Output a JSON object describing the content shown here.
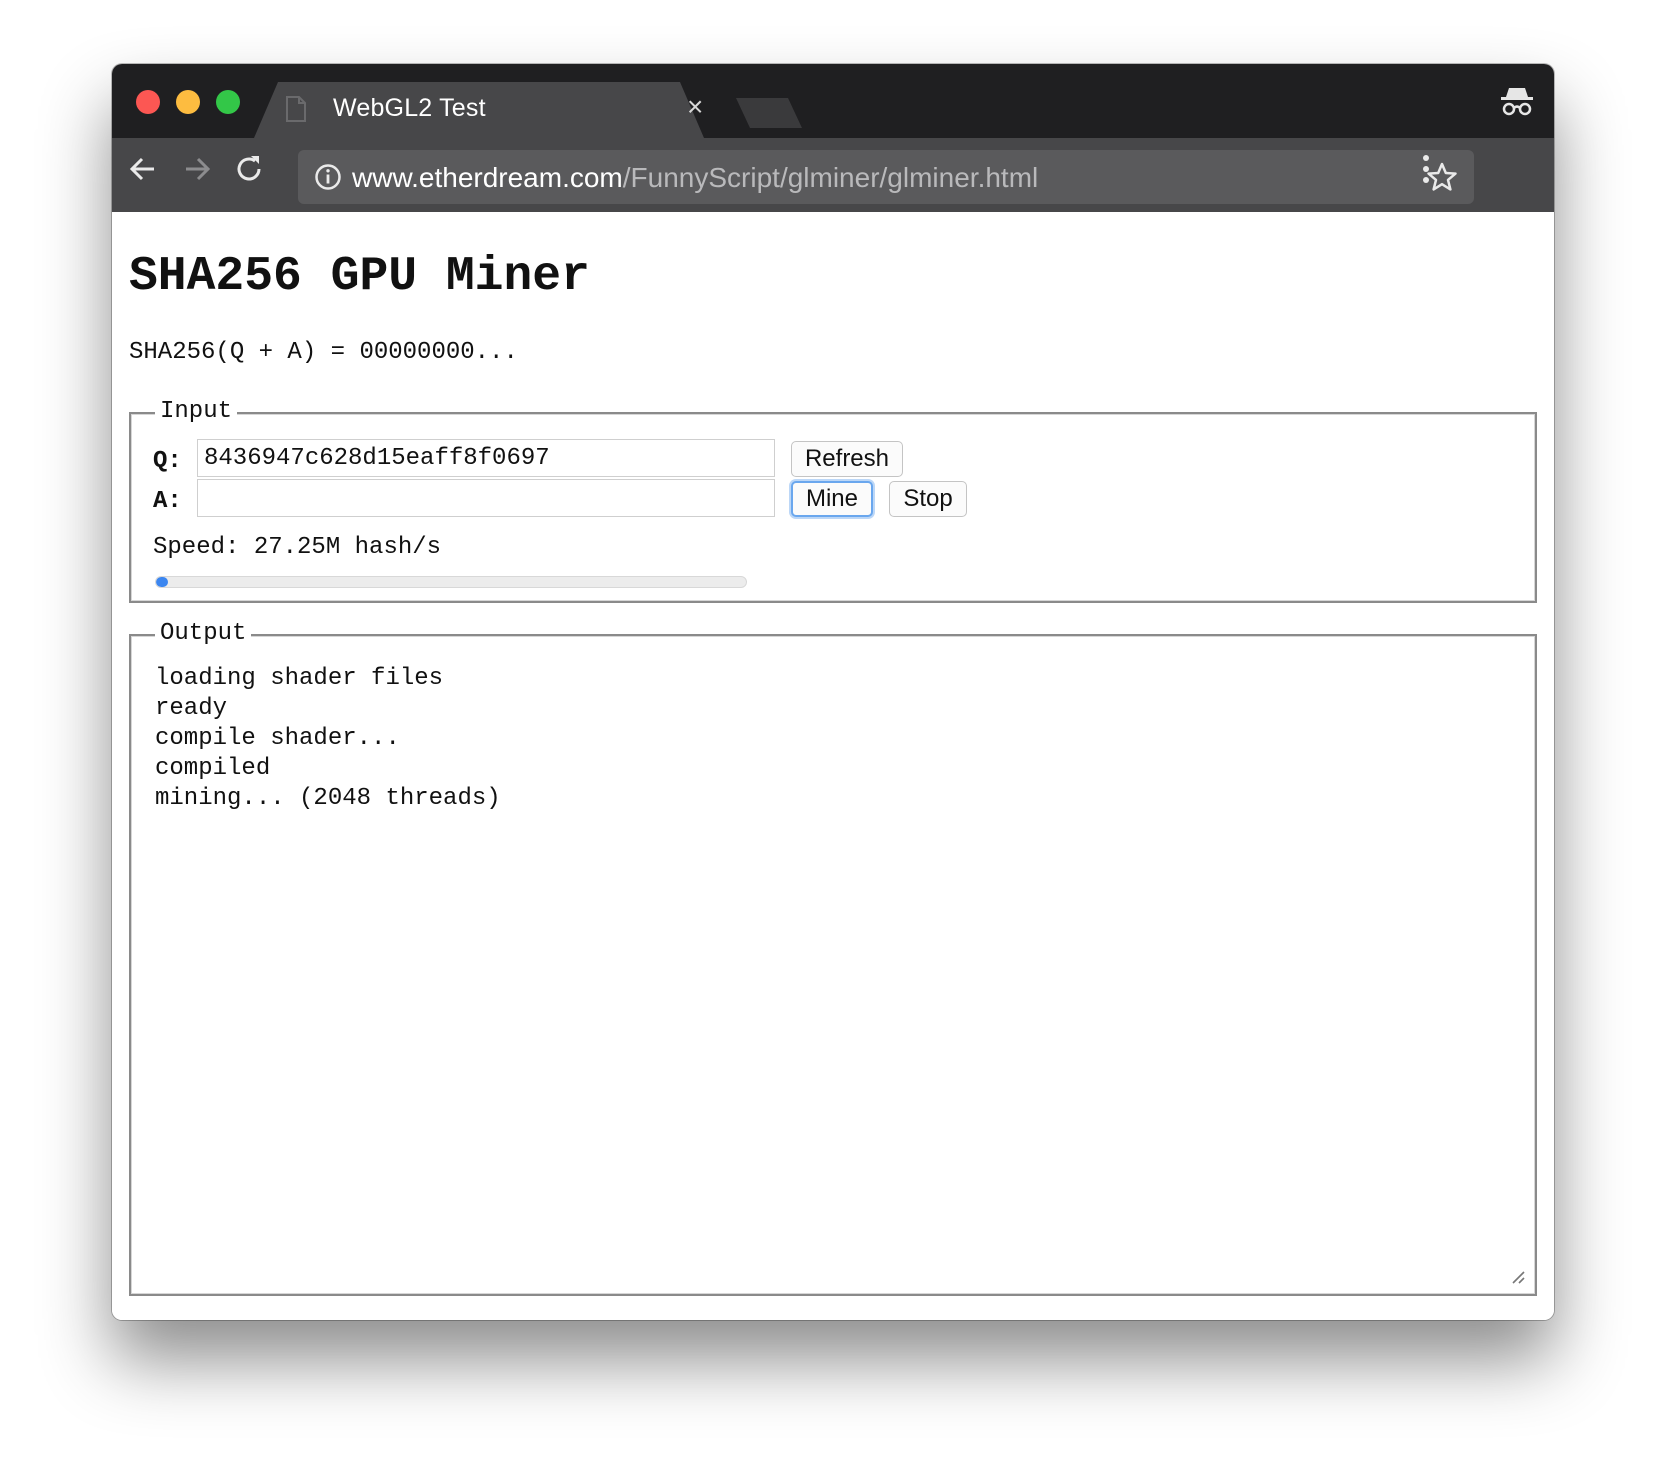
{
  "browser": {
    "tab_title": "WebGL2 Test",
    "tab_close": "×",
    "url_host": "www.etherdream.com",
    "url_path": "/FunnyScript/glminer/glminer.html",
    "icons": {
      "back": "back-arrow-icon",
      "forward": "forward-arrow-icon",
      "reload": "reload-icon",
      "info": "info-icon",
      "star": "star-icon",
      "menu": "menu-icon",
      "incognito": "incognito-icon"
    }
  },
  "page": {
    "title": "SHA256 GPU Miner",
    "formula": "SHA256(Q + A) = 00000000..."
  },
  "input_section": {
    "legend": "Input",
    "q_label": "Q:",
    "q_value": "8436947c628d15eaff8f0697",
    "a_label": "A:",
    "a_value": "",
    "refresh_label": "Refresh",
    "mine_label": "Mine",
    "stop_label": "Stop",
    "speed_text": "Speed: 27.25M hash/s",
    "progress_fraction": 0.02,
    "progress_color": "#3b86f0"
  },
  "output_section": {
    "legend": "Output",
    "lines": [
      "loading shader files",
      "ready",
      "compile shader...",
      "compiled",
      "mining... (2048 threads)"
    ]
  }
}
